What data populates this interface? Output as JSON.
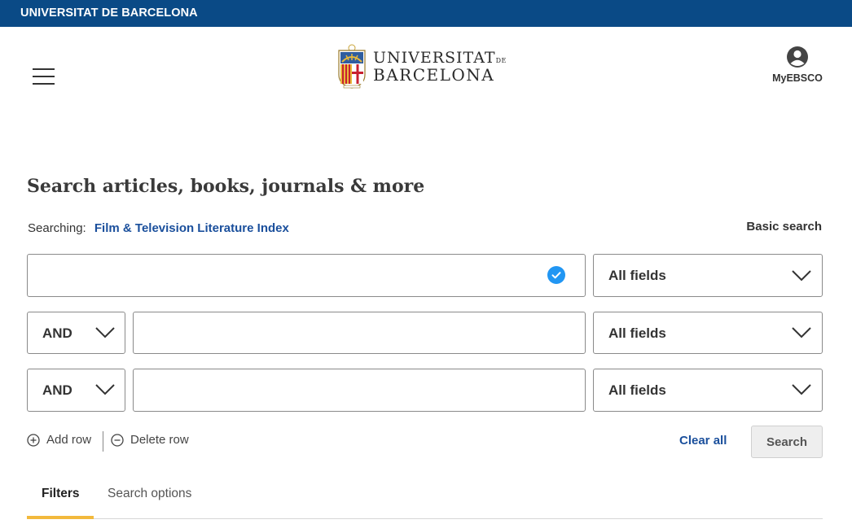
{
  "header": {
    "banner_title": "UNIVERSITAT DE BARCELONA",
    "logo": {
      "line1": "UNIVERSITAT",
      "line1_suffix": "DE",
      "line2": "BARCELONA",
      "colors": {
        "red": "#c8202f",
        "gold": "#e8b93b",
        "blue": "#2f5d9f"
      }
    },
    "account_label": "MyEBSCO",
    "brand_color": "#0a4a86"
  },
  "search": {
    "heading": "Search articles, books, journals & more",
    "searching_label": "Searching:",
    "database": "Film & Television Literature Index",
    "basic_search_link": "Basic search",
    "rows": [
      {
        "operator": null,
        "value": "",
        "field": "All fields"
      },
      {
        "operator": "AND",
        "value": "",
        "field": "All fields"
      },
      {
        "operator": "AND",
        "value": "",
        "field": "All fields"
      }
    ],
    "add_row": "Add row",
    "delete_row": "Delete row",
    "clear_all": "Clear all",
    "search_button": "Search"
  },
  "tabs": [
    {
      "label": "Filters",
      "active": true
    },
    {
      "label": "Search options",
      "active": false
    }
  ],
  "colors": {
    "link": "#1a4f9c",
    "tab_accent": "#f2b93c",
    "check": "#2196f3"
  },
  "icons": {
    "menu": "hamburger-icon",
    "account": "user-circle-icon",
    "check": "check-circle-icon",
    "dropdown": "chevron-down-icon",
    "add": "plus-circle-icon",
    "delete": "minus-circle-icon"
  }
}
